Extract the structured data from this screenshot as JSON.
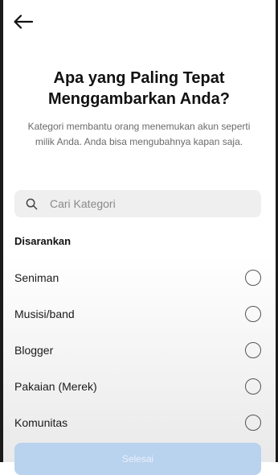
{
  "header": {
    "back_icon": "arrow-left-icon"
  },
  "title": "Apa yang Paling Tepat Menggambarkan Anda?",
  "subtitle": "Kategori membantu orang menemukan akun seperti milik Anda. Anda bisa mengubahnya kapan saja.",
  "search": {
    "placeholder": "Cari Kategori",
    "icon": "search-icon"
  },
  "section_label": "Disarankan",
  "categories": [
    {
      "label": "Seniman"
    },
    {
      "label": "Musisi/band"
    },
    {
      "label": "Blogger"
    },
    {
      "label": "Pakaian (Merek)"
    },
    {
      "label": "Komunitas"
    }
  ],
  "footer": {
    "done_label": "Selesai"
  },
  "colors": {
    "done_button_bg": "#b9d2ee",
    "search_bg": "#efefef"
  }
}
